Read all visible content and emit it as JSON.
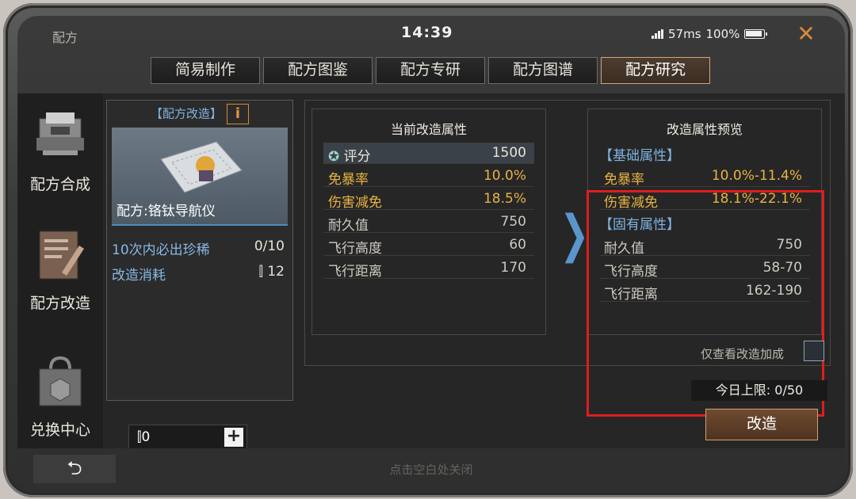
{
  "status_bar": {
    "title": "配方",
    "time": "14:39",
    "ping": "57ms",
    "battery": "100%"
  },
  "tabs": [
    {
      "label": "简易制作",
      "active": false
    },
    {
      "label": "配方图鉴",
      "active": false
    },
    {
      "label": "配方专研",
      "active": false
    },
    {
      "label": "配方图谱",
      "active": false
    },
    {
      "label": "配方研究",
      "active": true
    }
  ],
  "sidebar": {
    "items": [
      {
        "label": "配方合成",
        "icon": "printer-icon"
      },
      {
        "label": "配方改造",
        "icon": "document-pen-icon"
      },
      {
        "label": "兑换中心",
        "icon": "shopping-bag-icon"
      }
    ]
  },
  "card": {
    "header": "【配方改造】",
    "info_symbol": "i",
    "item_name": "配方:铬钛导航仪",
    "guarantee_label": "10次内必出珍稀",
    "guarantee_value": "0/10",
    "cost_label": "改造消耗",
    "cost_value": "12"
  },
  "quantity": {
    "value": "0",
    "plus": "+"
  },
  "current_attributes": {
    "title": "当前改造属性",
    "rows": [
      {
        "label": "评分",
        "value": "1500"
      },
      {
        "label": "免暴率",
        "value": "10.0%"
      },
      {
        "label": "伤害减免",
        "value": "18.5%"
      },
      {
        "label": "耐久值",
        "value": "750"
      },
      {
        "label": "飞行高度",
        "value": "60"
      },
      {
        "label": "飞行距离",
        "value": "170"
      }
    ]
  },
  "preview_attributes": {
    "title": "改造属性预览",
    "basic_title": "【基础属性】",
    "basic_rows": [
      {
        "label": "免暴率",
        "value": "10.0%-11.4%"
      },
      {
        "label": "伤害减免",
        "value": "18.1%-22.1%"
      }
    ],
    "inherent_title": "【固有属性】",
    "inherent_rows": [
      {
        "label": "耐久值",
        "value": "750"
      },
      {
        "label": "飞行高度",
        "value": "58-70"
      },
      {
        "label": "飞行距离",
        "value": "162-190"
      }
    ]
  },
  "options": {
    "only_show_label": "仅查看改造加成",
    "only_show_checked": false
  },
  "daily_limit": "今日上限: 0/50",
  "modify_button": "改造",
  "bottom": {
    "back_symbol": "⮌",
    "hint": "点击空白处关闭"
  },
  "colors": {
    "accent_gold": "#e8b343",
    "accent_blue": "#7fb2e0",
    "highlight_red": "#e01d1d",
    "close_orange": "#d88a3c"
  }
}
